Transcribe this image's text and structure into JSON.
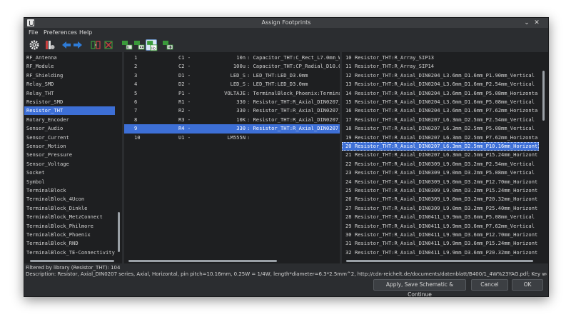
{
  "window": {
    "title": "Assign Footprints"
  },
  "menu": [
    "File",
    "Preferences",
    "Help"
  ],
  "libraries": {
    "items": [
      "RF_Antenna",
      "RF_Module",
      "RF_Shielding",
      "Relay_SMD",
      "Relay_THT",
      "Resistor_SMD",
      "Resistor_THT",
      "Rotary_Encoder",
      "Sensor_Audio",
      "Sensor_Current",
      "Sensor_Motion",
      "Sensor_Pressure",
      "Sensor_Voltage",
      "Socket",
      "Symbol",
      "TerminalBlock",
      "TerminalBlock_4Ucon",
      "TerminalBlock_Dinkle",
      "TerminalBlock_MetzConnect",
      "TerminalBlock_Philmore",
      "TerminalBlock_Phoenix",
      "TerminalBlock_RND",
      "TerminalBlock_TE-Connectivity"
    ],
    "selected_index": 6
  },
  "components": {
    "rows": [
      {
        "num": "1",
        "ref": "C1 -",
        "value": "10n",
        "fp": ": Capacitor_THT:C_Rect_L7.0mm_W3.5mm_P"
      },
      {
        "num": "2",
        "ref": "C2 -",
        "value": "100u",
        "fp": ": Capacitor_THT:CP_Radial_D10.0mm_P5.0"
      },
      {
        "num": "3",
        "ref": "D1 -",
        "value": "LED_S",
        "fp": ": LED_THT:LED_D3.0mm"
      },
      {
        "num": "4",
        "ref": "D2 -",
        "value": "LED_S",
        "fp": ": LED_THT:LED_D3.0mm"
      },
      {
        "num": "5",
        "ref": "P1 -",
        "value": "VOLTAJE",
        "fp": ": TerminalBlock_Phoenix:TerminalBlock_"
      },
      {
        "num": "6",
        "ref": "R1 -",
        "value": "330",
        "fp": ": Resistor_THT:R_Axial_DIN0207_L6.3mm_"
      },
      {
        "num": "7",
        "ref": "R2 -",
        "value": "330",
        "fp": ": Resistor_THT:R_Axial_DIN0207_L6.3mm_"
      },
      {
        "num": "8",
        "ref": "R3 -",
        "value": "10K",
        "fp": ": Resistor_THT:R_Axial_DIN0207_L6.3mm_"
      },
      {
        "num": "9",
        "ref": "R4 -",
        "value": "330",
        "fp": ": Resistor_THT:R_Axial_DIN0207_L6.3mm_"
      },
      {
        "num": "10",
        "ref": "U1 -",
        "value": "LM555N",
        "fp": ":"
      }
    ],
    "selected_index": 8
  },
  "footprints": {
    "rows": [
      {
        "num": "10",
        "name": "Resistor_THT:R_Array_SIP13"
      },
      {
        "num": "11",
        "name": "Resistor_THT:R_Array_SIP14"
      },
      {
        "num": "12",
        "name": "Resistor_THT:R_Axial_DIN0204_L3.6mm_D1.6mm_P1.90mm_Vertical"
      },
      {
        "num": "13",
        "name": "Resistor_THT:R_Axial_DIN0204_L3.6mm_D1.6mm_P2.54mm_Vertical"
      },
      {
        "num": "14",
        "name": "Resistor_THT:R_Axial_DIN0204_L3.6mm_D1.6mm_P5.08mm_Horizonta"
      },
      {
        "num": "15",
        "name": "Resistor_THT:R_Axial_DIN0204_L3.6mm_D1.6mm_P5.08mm_Vertical"
      },
      {
        "num": "16",
        "name": "Resistor_THT:R_Axial_DIN0204_L3.6mm_D1.6mm_P7.62mm_Horizonta"
      },
      {
        "num": "17",
        "name": "Resistor_THT:R_Axial_DIN0207_L6.3mm_D2.5mm_P2.54mm_Vertical"
      },
      {
        "num": "18",
        "name": "Resistor_THT:R_Axial_DIN0207_L6.3mm_D2.5mm_P5.08mm_Vertical"
      },
      {
        "num": "19",
        "name": "Resistor_THT:R_Axial_DIN0207_L6.3mm_D2.5mm_P7.62mm_Horizonta"
      },
      {
        "num": "20",
        "name": "Resistor_THT:R_Axial_DIN0207_L6.3mm_D2.5mm_P10.16mm_Horizont"
      },
      {
        "num": "21",
        "name": "Resistor_THT:R_Axial_DIN0207_L6.3mm_D2.5mm_P15.24mm_Horizont"
      },
      {
        "num": "22",
        "name": "Resistor_THT:R_Axial_DIN0309_L9.0mm_D3.2mm_P2.54mm_Vertical"
      },
      {
        "num": "23",
        "name": "Resistor_THT:R_Axial_DIN0309_L9.0mm_D3.2mm_P5.08mm_Vertical"
      },
      {
        "num": "24",
        "name": "Resistor_THT:R_Axial_DIN0309_L9.0mm_D3.2mm_P12.70mm_Horizont"
      },
      {
        "num": "25",
        "name": "Resistor_THT:R_Axial_DIN0309_L9.0mm_D3.2mm_P15.24mm_Horizont"
      },
      {
        "num": "26",
        "name": "Resistor_THT:R_Axial_DIN0309_L9.0mm_D3.2mm_P20.32mm_Horizont"
      },
      {
        "num": "27",
        "name": "Resistor_THT:R_Axial_DIN0309_L9.0mm_D3.2mm_P25.40mm_Horizont"
      },
      {
        "num": "28",
        "name": "Resistor_THT:R_Axial_DIN0411_L9.9mm_D3.6mm_P5.08mm_Vertical"
      },
      {
        "num": "29",
        "name": "Resistor_THT:R_Axial_DIN0411_L9.9mm_D3.6mm_P7.62mm_Vertical"
      },
      {
        "num": "30",
        "name": "Resistor_THT:R_Axial_DIN0411_L9.9mm_D3.6mm_P12.70mm_Horizont"
      },
      {
        "num": "31",
        "name": "Resistor_THT:R_Axial_DIN0411_L9.9mm_D3.6mm_P15.24mm_Horizont"
      },
      {
        "num": "32",
        "name": "Resistor_THT:R_Axial_DIN0411_L9.9mm_D3.6mm_P20.32mm_Horizont"
      }
    ],
    "selected_index": 10
  },
  "status": {
    "filter": "Filtered by library (Resistor_THT): 104",
    "description": "Description: Resistor, Axial_DIN0207 series, Axial, Horizontal, pin pitch=10.16mm, 0.25W = 1/4W, length*diameter=6.3*2.5mm^2, http://cdn-reichelt.de/documents/datenblatt/B400/1_4W%23YAG.pdf; Key words: Resistor"
  },
  "buttons": {
    "apply": "Apply, Save Schematic & Continue",
    "cancel": "Cancel",
    "ok": "OK"
  },
  "colors": {
    "selection": "#3d6fd6",
    "accent_green": "#3a9a3a",
    "accent_blue": "#2e7bd6"
  }
}
